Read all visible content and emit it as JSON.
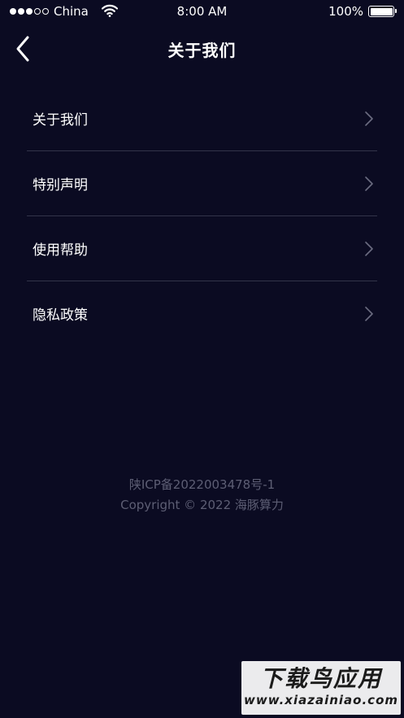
{
  "status_bar": {
    "carrier": "China",
    "time": "8:00 AM",
    "battery": "100%",
    "signal_bars_filled": 3,
    "signal_bars_total": 5
  },
  "nav": {
    "title": "关于我们"
  },
  "menu": {
    "items": [
      {
        "label": "关于我们"
      },
      {
        "label": "特别声明"
      },
      {
        "label": "使用帮助"
      },
      {
        "label": "隐私政策"
      }
    ]
  },
  "footer": {
    "icp": "陕ICP备2022003478号-1",
    "copyright": "Copyright © 2022 海豚算力"
  },
  "watermark": {
    "title": "下载鸟应用",
    "url": "www.xiazainiao.com"
  },
  "colors": {
    "background": "#0b0b22",
    "divider": "#33344a",
    "footer_text": "#5d5e74",
    "chevron": "#6b6c80"
  }
}
